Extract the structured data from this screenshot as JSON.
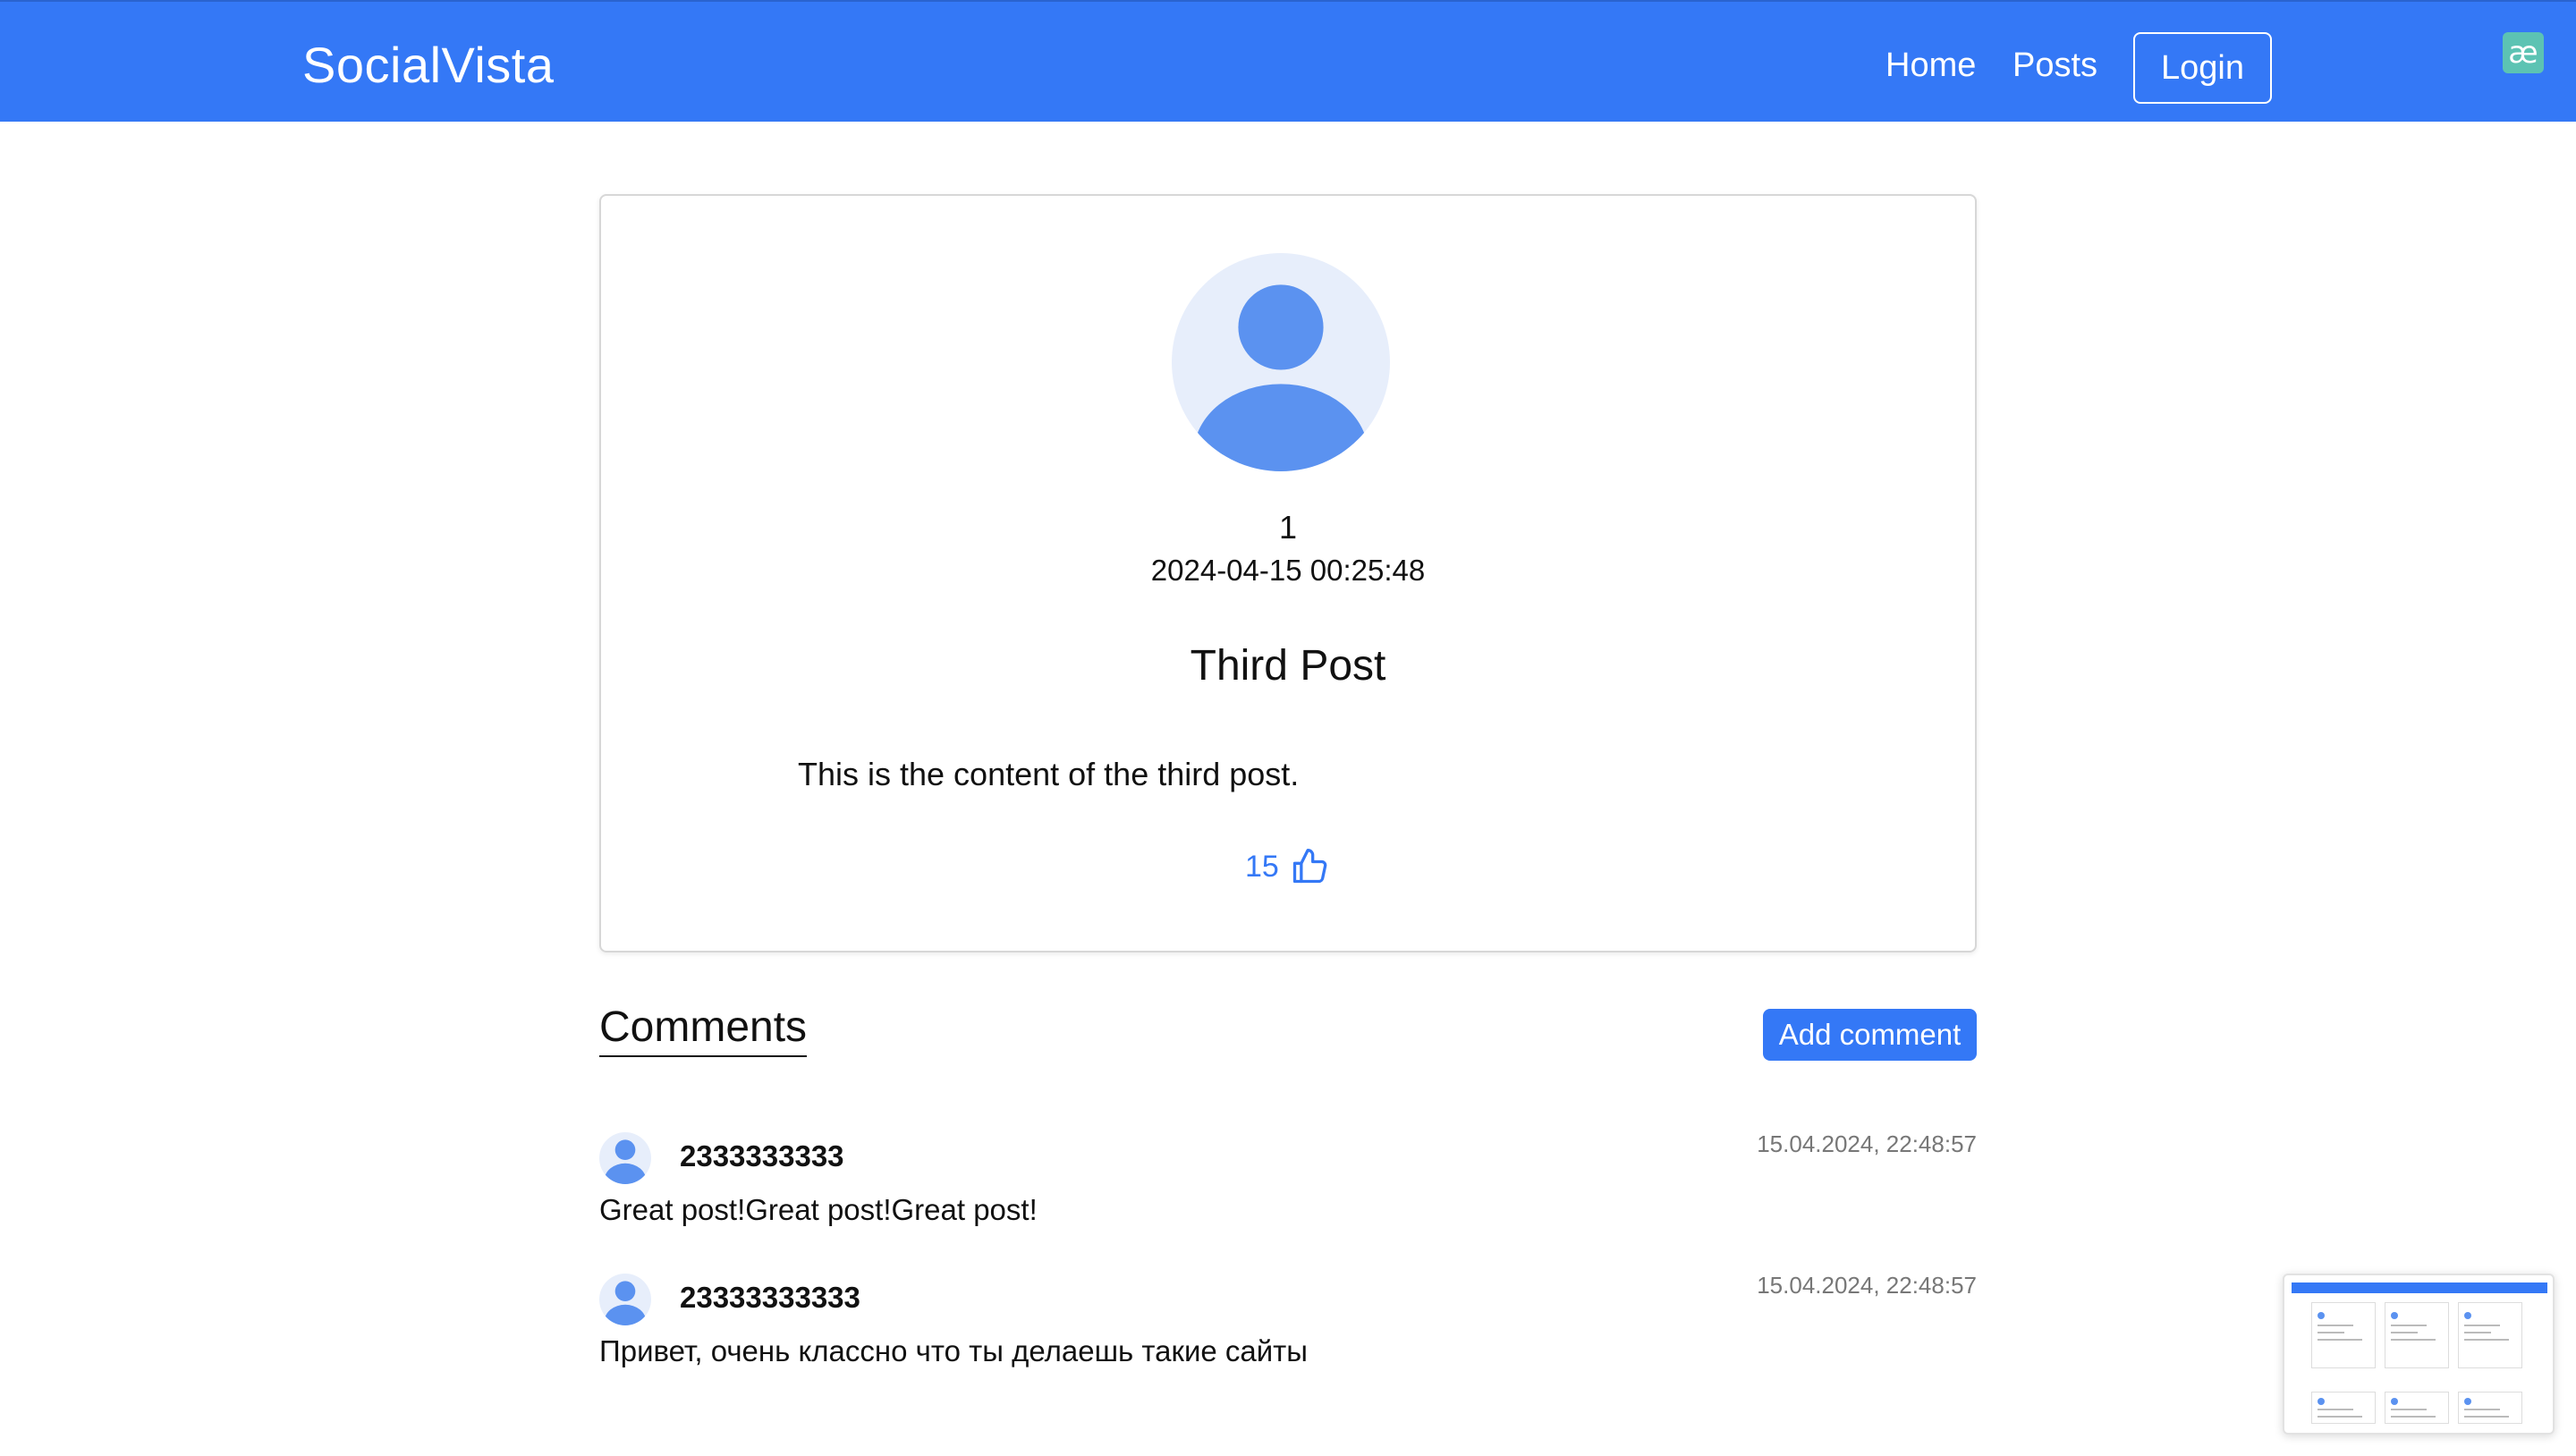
{
  "navbar": {
    "brand": "SocialVista",
    "links": [
      "Home",
      "Posts"
    ],
    "login_label": "Login",
    "extension_icon": "ae-ligature-icon",
    "extension_glyph": "æ"
  },
  "post": {
    "author": "1",
    "date": "2024-04-15 00:25:48",
    "title": "Third Post",
    "content": "This is the content of the third post.",
    "likes": "15",
    "like_icon": "thumbs-up-icon",
    "avatar_icon": "user-avatar-icon"
  },
  "comments": {
    "heading": "Comments",
    "add_label": "Add comment",
    "items": [
      {
        "author": "2333333333",
        "date": "15.04.2024, 22:48:57",
        "text": "Great post!Great post!Great post!"
      },
      {
        "author": "23333333333",
        "date": "15.04.2024, 22:48:57",
        "text": "Привет, очень классно что ты делаешь такие сайты"
      }
    ]
  },
  "colors": {
    "accent": "#3478f6",
    "avatar_bg": "#e7eefb",
    "avatar_fg": "#5b92f0",
    "muted_text": "#777777"
  }
}
